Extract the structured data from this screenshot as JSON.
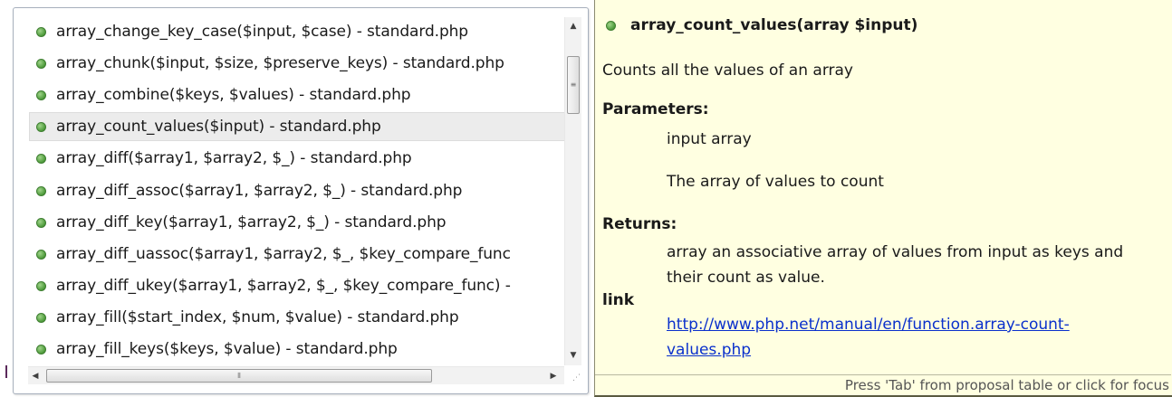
{
  "proposals": {
    "items": [
      {
        "label": "array_change_key_case($input, $case) - standard.php"
      },
      {
        "label": "array_chunk($input, $size, $preserve_keys) - standard.php"
      },
      {
        "label": "array_combine($keys, $values) - standard.php"
      },
      {
        "label": "array_count_values($input) - standard.php",
        "selected": true
      },
      {
        "label": "array_diff($array1, $array2, $_) - standard.php"
      },
      {
        "label": "array_diff_assoc($array1, $array2, $_) - standard.php"
      },
      {
        "label": "array_diff_key($array1, $array2, $_) - standard.php"
      },
      {
        "label": "array_diff_uassoc($array1, $array2, $_, $key_compare_func"
      },
      {
        "label": "array_diff_ukey($array1, $array2, $_, $key_compare_func) -"
      },
      {
        "label": "array_fill($start_index, $num, $value) - standard.php"
      },
      {
        "label": "array_fill_keys($keys, $value) - standard.php"
      }
    ],
    "icon": "public-method-icon",
    "accent_color": "#4d9a3a"
  },
  "doc": {
    "title": "array_count_values(array $input)",
    "summary": "Counts all the values of an array",
    "parameters_heading": "Parameters:",
    "param_name": "input array",
    "param_desc": "The array of values to count",
    "returns_heading": "Returns:",
    "returns_line1": "array an associative array of values from input as keys and",
    "returns_line2": "their count as value.",
    "link_heading": "link",
    "link_line1": "http://www.php.net/manual/en/function.array-count-",
    "link_line2": "values.php",
    "status": "Press 'Tab' from proposal table or click for focus",
    "background_color": "#ffffe1",
    "link_color": "#0a30cc"
  }
}
